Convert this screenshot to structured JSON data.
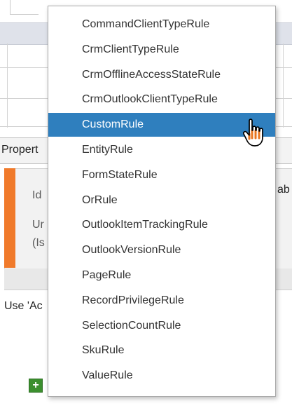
{
  "background": {
    "properties_header": "Propert",
    "fields": {
      "line1": "Id",
      "line2": "Ur",
      "line3": "(Is",
      "right_fragment": "ab"
    },
    "use_text": "Use 'Ac",
    "add_label": "+"
  },
  "dropdown": {
    "items": [
      {
        "label": "CommandClientTypeRule"
      },
      {
        "label": "CrmClientTypeRule"
      },
      {
        "label": "CrmOfflineAccessStateRule"
      },
      {
        "label": "CrmOutlookClientTypeRule"
      },
      {
        "label": "CustomRule"
      },
      {
        "label": "EntityRule"
      },
      {
        "label": "FormStateRule"
      },
      {
        "label": "OrRule"
      },
      {
        "label": "OutlookItemTrackingRule"
      },
      {
        "label": "OutlookVersionRule"
      },
      {
        "label": "PageRule"
      },
      {
        "label": "RecordPrivilegeRule"
      },
      {
        "label": "SelectionCountRule"
      },
      {
        "label": "SkuRule"
      },
      {
        "label": "ValueRule"
      }
    ],
    "selected_label": "CustomRule",
    "selected_color": "#2f7fbe"
  },
  "cursor": {
    "icon": "hand-pointer-icon"
  },
  "colors": {
    "accent": "#f07a2b",
    "add_button": "#3b8f2e"
  }
}
